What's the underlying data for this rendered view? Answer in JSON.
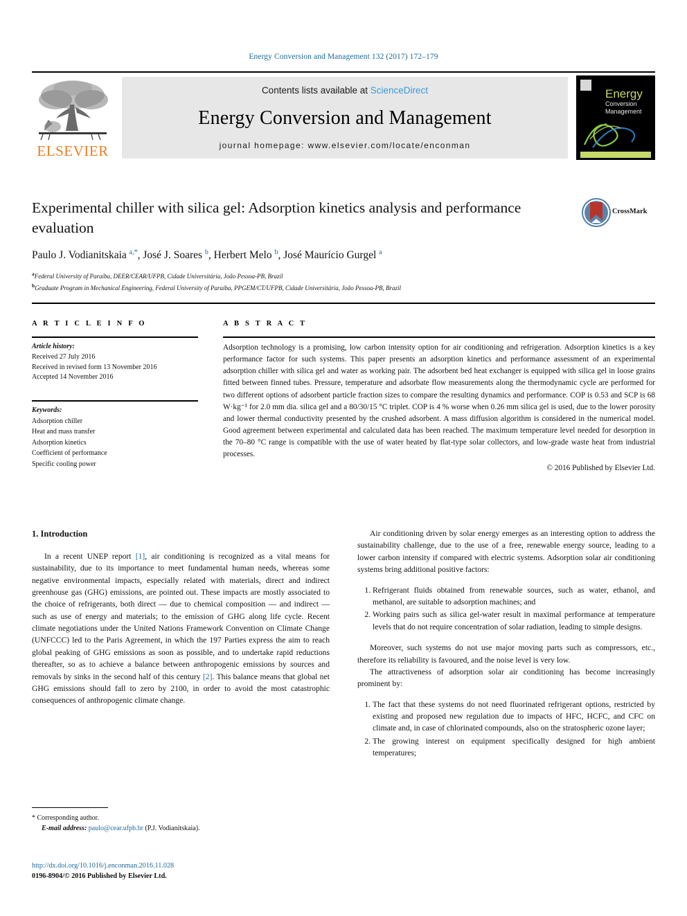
{
  "running_head": "Energy Conversion and Management 132 (2017) 172–179",
  "masthead": {
    "publisher_name": "ELSEVIER",
    "contents_prefix": "Contents lists available at ",
    "contents_link": "ScienceDirect",
    "journal_title": "Energy Conversion and Management",
    "homepage": "journal homepage: www.elsevier.com/locate/enconman",
    "cover": {
      "line1": "Energy",
      "line2": "Conversion",
      "line3": "Management"
    }
  },
  "article": {
    "title": "Experimental chiller with silica gel: Adsorption kinetics analysis and performance evaluation",
    "crossmark_label": "CrossMark",
    "authors_html": "Paulo J. Vodianitskaia <sup>a,*</sup>, José J. Soares <sup>b</sup>, Herbert Melo <sup>b</sup>, José Maurício Gurgel <sup>a</sup>",
    "affiliations": [
      {
        "marker": "a",
        "text": "Federal University of Paraíba, DEER/CEAR/UFPB, Cidade Universitária, João Pessoa-PB, Brazil"
      },
      {
        "marker": "b",
        "text": "Graduate Program in Mechanical Engineering, Federal University of Paraíba, PPGEM/CT/UFPB, Cidade Universitária, João Pessoa-PB, Brazil"
      }
    ]
  },
  "info": {
    "heading": "A R T I C L E   I N F O",
    "history_label": "Article history:",
    "history": [
      "Received 27 July 2016",
      "Received in revised form 13 November 2016",
      "Accepted 14 November 2016"
    ],
    "keywords_label": "Keywords:",
    "keywords": [
      "Adsorption chiller",
      "Heat and mass transfer",
      "Adsorption kinetics",
      "Coefficient of performance",
      "Specific cooling power"
    ]
  },
  "abstract": {
    "heading": "A B S T R A C T",
    "text": "Adsorption technology is a promising, low carbon intensity option for air conditioning and refrigeration. Adsorption kinetics is a key performance factor for such systems. This paper presents an adsorption kinetics and performance assessment of an experimental adsorption chiller with silica gel and water as working pair. The adsorbent bed heat exchanger is equipped with silica gel in loose grains fitted between finned tubes. Pressure, temperature and adsorbate flow measurements along the thermodynamic cycle are performed for two different options of adsorbent particle fraction sizes to compare the resulting dynamics and performance. COP is 0.53 and SCP is 68 W·kg⁻¹ for 2.0 mm dia. silica gel and a 80/30/15 °C triplet. COP is 4 % worse when 0.26 mm silica gel is used, due to the lower porosity and lower thermal conductivity presented by the crushed adsorbent. A mass diffusion algorithm is considered in the numerical model. Good agreement between experimental and calculated data has been reached. The maximum temperature level needed for desorption in the 70–80 °C range is compatible with the use of water heated by flat-type solar collectors, and low-grade waste heat from industrial processes.",
    "copyright": "© 2016 Published by Elsevier Ltd."
  },
  "body": {
    "section_title": "1. Introduction",
    "left_paragraphs": [
      "In a recent UNEP report [1], air conditioning is recognized as a vital means for sustainability, due to its importance to meet fundamental human needs, whereas some negative environmental impacts, especially related with materials, direct and indirect greenhouse gas (GHG) emissions, are pointed out. These impacts are mostly associated to the choice of refrigerants, both direct — due to chemical composition — and indirect — such as use of energy and materials; to the emission of GHG along life cycle. Recent climate negotiations under the United Nations Framework Convention on Climate Change (UNFCCC) led to the Paris Agreement, in which the 197 Parties express the aim to reach global peaking of GHG emissions as soon as possible, and to undertake rapid reductions thereafter, so as to achieve a balance between anthropogenic emissions by sources and removals by sinks in the second half of this century [2]. This balance means that global net GHG emissions should fall to zero by 2100, in order to avoid the most catastrophic consequences of anthropogenic climate change."
    ],
    "left_ref_1": "[1]",
    "left_ref_2": "[2]",
    "right_para_1": "Air conditioning driven by solar energy emerges as an interesting option to address the sustainability challenge, due to the use of a free, renewable energy source, leading to a lower carbon intensity if compared with electric systems. Adsorption solar air conditioning systems bring additional positive factors:",
    "right_list_1": [
      "Refrigerant fluids obtained from renewable sources, such as water, ethanol, and methanol, are suitable to adsorption machines; and",
      "Working pairs such as silica gel-water result in maximal performance at temperature levels that do not require concentration of solar radiation, leading to simple designs."
    ],
    "right_para_2": "Moreover, such systems do not use major moving parts such as compressors, etc., therefore its reliability is favoured, and the noise level is very low.",
    "right_para_3": "The attractiveness of adsorption solar air conditioning has become increasingly prominent by:",
    "right_list_2": [
      "The fact that these systems do not need fluorinated refrigerant options, restricted by existing and proposed new regulation due to impacts of HFC, HCFC, and CFC on climate and, in case of chlorinated compounds, also on the stratospheric ozone layer;",
      "The growing interest on equipment specifically designed for high ambient temperatures;"
    ]
  },
  "footnote": {
    "star": "*",
    "corresponding": "Corresponding author.",
    "email_label": "E-mail address:",
    "email": "paulo@cear.ufpb.br",
    "email_suffix": "(P.J. Vodianitskaia)."
  },
  "footer": {
    "doi": "http://dx.doi.org/10.1016/j.enconman.2016.11.028",
    "issn_line": "0196-8904/© 2016 Published by Elsevier Ltd."
  },
  "colors": {
    "link": "#1b6a9c",
    "sciencedirect": "#3a9ad9",
    "elsevier_orange": "#ef7d21",
    "masthead_grey": "#e7e7e7"
  }
}
